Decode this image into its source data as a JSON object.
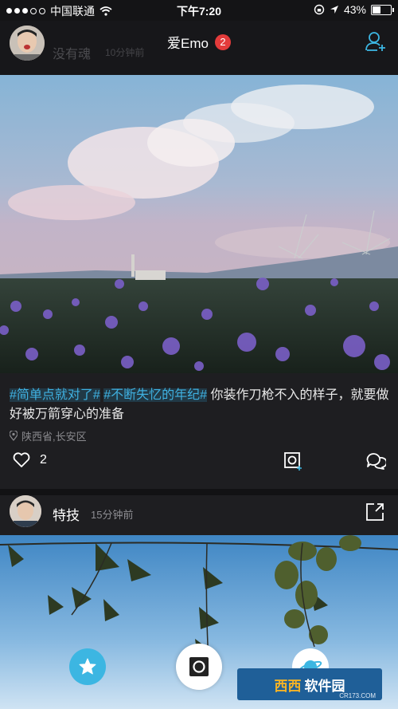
{
  "status_bar": {
    "carrier": "中国联通",
    "time": "下午7:20",
    "battery": "43%",
    "battery_level": 0.43
  },
  "header": {
    "title": "爱Emo",
    "notification_count": "2",
    "ghost_username": "没有魂",
    "ghost_time": "10分钟前"
  },
  "post1": {
    "tags": [
      "#简单点就对了#",
      "#不断失忆的年纪#"
    ],
    "text": "你装作刀枪不入的样子，就要做好被万箭穿心的准备",
    "location": "陕西省,长安区",
    "like_count": "2"
  },
  "post2": {
    "username": "特技",
    "time": "15分钟前"
  },
  "watermark": {
    "brand_a": "西西",
    "brand_b": "软件园",
    "url": "CR173.COM"
  },
  "colors": {
    "accent": "#3cb6e2",
    "badge": "#e33b3b",
    "tag": "#3fb0e0"
  },
  "icons": [
    "wifi-icon",
    "lock-rotation-icon",
    "location-arrow-icon",
    "add-user-icon",
    "heart-icon",
    "camera-square-icon",
    "comment-icon",
    "share-icon",
    "star-icon",
    "camera-icon",
    "planet-icon",
    "location-pin-icon"
  ]
}
